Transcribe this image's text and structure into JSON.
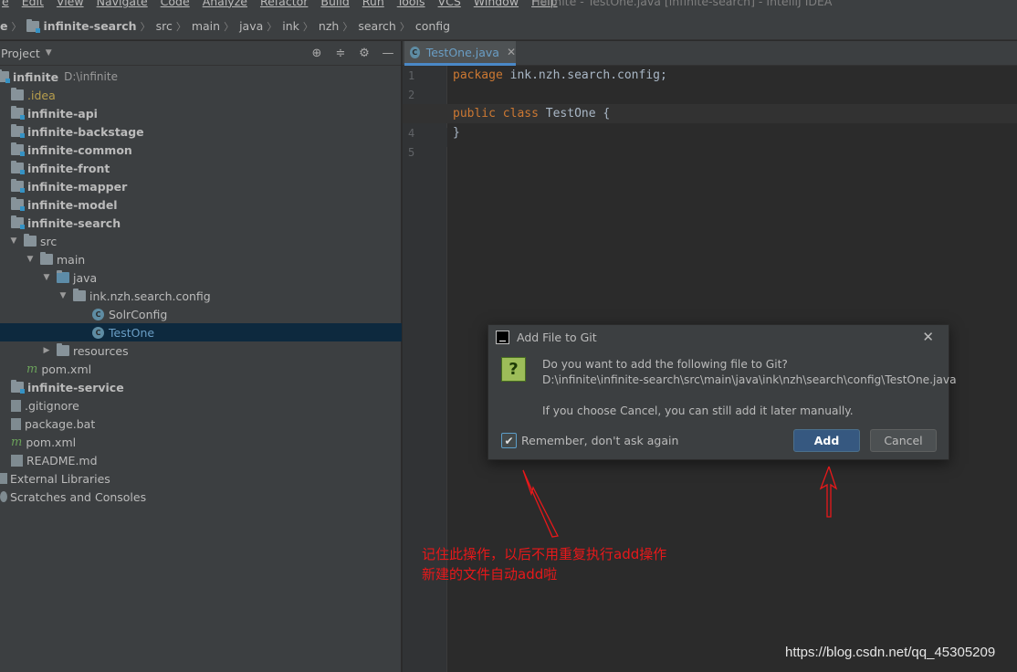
{
  "menubar": {
    "items": [
      "e",
      "Edit",
      "View",
      "Navigate",
      "Code",
      "Analyze",
      "Refactor",
      "Build",
      "Run",
      "Tools",
      "VCS",
      "Window",
      "Help"
    ],
    "window_title": "infinite - TestOne.java [infinite-search] - IntelliJ IDEA"
  },
  "breadcrumb": {
    "items": [
      "e",
      "infinite-search",
      "src",
      "main",
      "java",
      "ink",
      "nzh",
      "search",
      "config"
    ]
  },
  "project": {
    "title": "Project",
    "tree": [
      {
        "label": "infinite",
        "path": "D:\\infinite"
      },
      {
        "label": ".idea"
      },
      {
        "label": "infinite-api"
      },
      {
        "label": "infinite-backstage"
      },
      {
        "label": "infinite-common"
      },
      {
        "label": "infinite-front"
      },
      {
        "label": "infinite-mapper"
      },
      {
        "label": "infinite-model"
      },
      {
        "label": "infinite-search"
      },
      {
        "label": "src"
      },
      {
        "label": "main"
      },
      {
        "label": "java"
      },
      {
        "label": "ink.nzh.search.config"
      },
      {
        "label": "SolrConfig"
      },
      {
        "label": "TestOne"
      },
      {
        "label": "resources"
      },
      {
        "label": "pom.xml"
      },
      {
        "label": "infinite-service"
      },
      {
        "label": ".gitignore"
      },
      {
        "label": "package.bat"
      },
      {
        "label": "pom.xml"
      },
      {
        "label": "README.md"
      },
      {
        "label": "External Libraries"
      },
      {
        "label": "Scratches and Consoles"
      }
    ]
  },
  "editor": {
    "tab_label": "TestOne.java",
    "line_numbers": [
      "1",
      "2",
      "3",
      "4",
      "5"
    ],
    "lines": {
      "l1_kw": "package",
      "l1_rest": " ink.nzh.search.config;",
      "l3_kw1": "public",
      "l3_kw2": "class",
      "l3_rest": " TestOne {",
      "l4": "}"
    }
  },
  "dialog": {
    "title": "Add File to Git",
    "question": "Do you want to add the following file to Git?",
    "file_path": "D:\\infinite\\infinite-search\\src\\main\\java\\ink\\nzh\\search\\config\\TestOne.java",
    "note": "If you choose Cancel, you can still add it later manually.",
    "remember_label": "Remember, don't ask again",
    "remember_checked": true,
    "add_label": "Add",
    "cancel_label": "Cancel"
  },
  "annotation": {
    "line1": "记住此操作，以后不用重复执行add操作",
    "line2": "新建的文件自动add啦",
    "color": "#e8181a"
  },
  "watermark": "https://blog.csdn.net/qq_45305209"
}
